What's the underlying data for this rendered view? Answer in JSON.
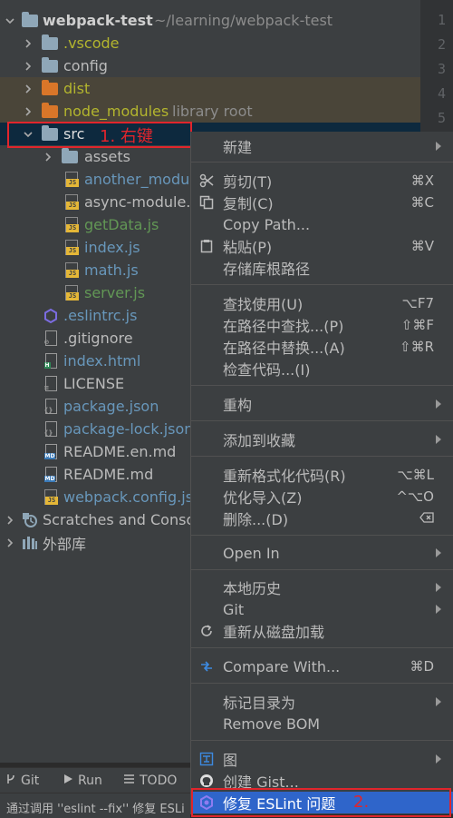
{
  "gutter": {
    "line_numbers": [
      "1",
      "2",
      "3",
      "4",
      "5"
    ]
  },
  "tree": {
    "project_name": "webpack-test",
    "project_path": "~/learning/webpack-test",
    "folders": {
      "vscode": ".vscode",
      "config": "config",
      "dist": "dist",
      "node_modules": "node_modules",
      "node_modules_hint": "library root",
      "src": "src",
      "assets": "assets"
    },
    "src_files": [
      "another_modul",
      "async-module.j",
      "getData.js",
      "index.js",
      "math.js",
      "server.js"
    ],
    "root_files": [
      ".eslintrc.js",
      ".gitignore",
      "index.html",
      "LICENSE",
      "package.json",
      "package-lock.json",
      "README.en.md",
      "README.md",
      "webpack.config.js"
    ],
    "scratches": "Scratches and Conso",
    "external_libs": "外部库"
  },
  "annotations": {
    "step1": "1. 右键",
    "step2": "2."
  },
  "context_menu": {
    "new": "新建",
    "cut": "剪切(T)",
    "cut_shortcut": "⌘X",
    "copy": "复制(C)",
    "copy_shortcut": "⌘C",
    "copy_path": "Copy Path...",
    "paste": "粘贴(P)",
    "paste_shortcut": "⌘V",
    "repo_root": "存储库根路径",
    "find_usages": "查找使用(U)",
    "find_usages_shortcut": "⌥F7",
    "find_in_path": "在路径中查找...(P)",
    "find_in_path_shortcut": "⇧⌘F",
    "replace_in_path": "在路径中替换...(A)",
    "replace_in_path_shortcut": "⇧⌘R",
    "inspect": "检查代码...(I)",
    "refactor": "重构",
    "add_favorites": "添加到收藏",
    "reformat": "重新格式化代码(R)",
    "reformat_shortcut": "⌥⌘L",
    "optimize_imports": "优化导入(Z)",
    "optimize_imports_shortcut": "^⌥O",
    "delete": "删除...(D)",
    "open_in": "Open In",
    "local_history": "本地历史",
    "git": "Git",
    "reload": "重新从磁盘加载",
    "compare_with": "Compare With...",
    "compare_with_shortcut": "⌘D",
    "mark_dir": "标记目录为",
    "remove_bom": "Remove BOM",
    "diagrams": "图",
    "create_gist": "创建 Gist...",
    "fix_eslint": "修复 ESLint 问题"
  },
  "toolbar": {
    "git": "Git",
    "run": "Run",
    "todo": "TODO"
  },
  "status": {
    "text": "通过调用 ''eslint --fix'' 修复 ESLi"
  },
  "colors": {
    "selection": "#2f65ca",
    "red_callout": "#e0252c",
    "folder": "#8fa7b8",
    "excluded_folder": "#d97629"
  }
}
